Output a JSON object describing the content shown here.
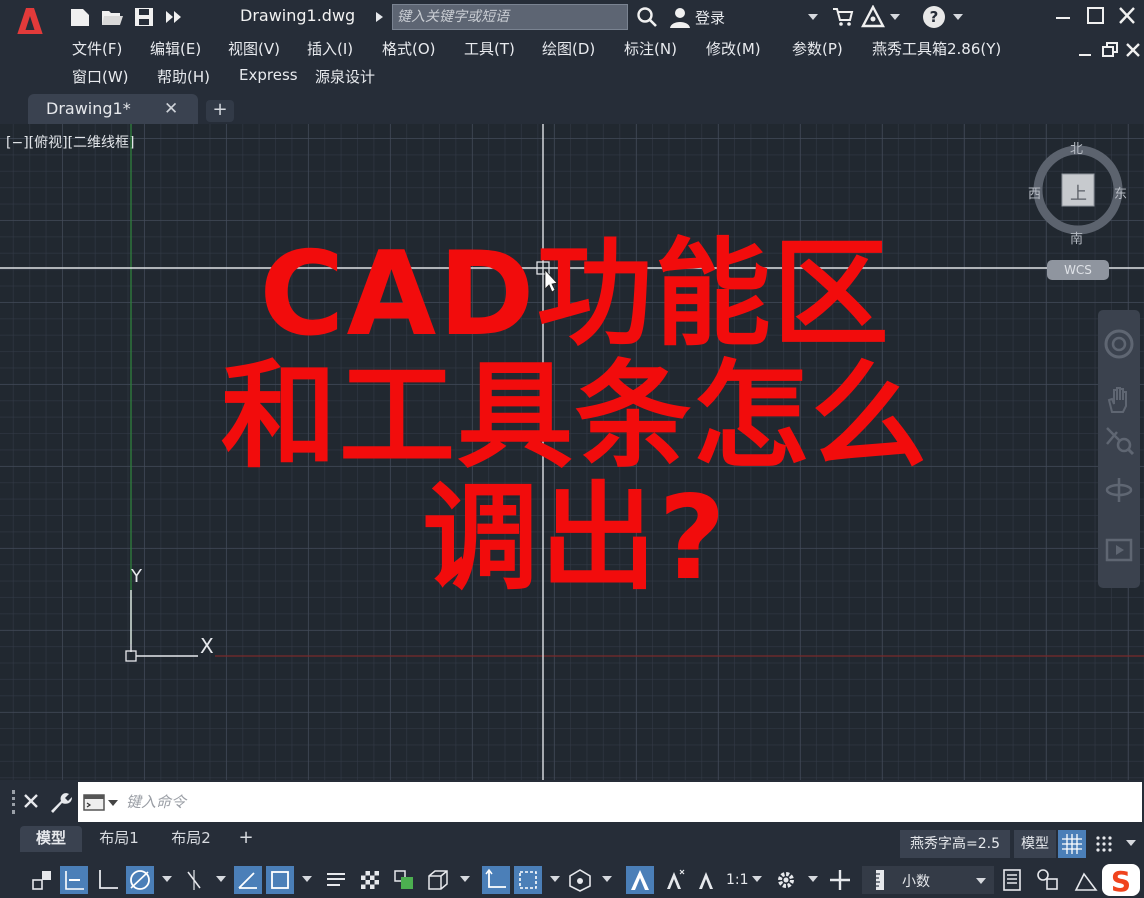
{
  "title_bar": {
    "filename": "Drawing1.dwg",
    "search_placeholder": "键入关键字或短语",
    "login_label": "登录"
  },
  "menu": {
    "items_row1": [
      "文件(F)",
      "编辑(E)",
      "视图(V)",
      "插入(I)",
      "格式(O)",
      "工具(T)",
      "绘图(D)",
      "标注(N)",
      "修改(M)",
      "参数(P)",
      "燕秀工具箱2.86(Y)"
    ],
    "items_row2": [
      "窗口(W)",
      "帮助(H)",
      "Express",
      "源泉设计"
    ]
  },
  "tabs": {
    "drawing_tab": "Drawing1*"
  },
  "canvas": {
    "viewport_label": "[−][俯视][二维线框]",
    "overlay_lines": [
      "CAD功能区",
      "和工具条怎么",
      "调出?"
    ],
    "overlay_color": "#f20c0c",
    "ucs_y": "Y",
    "ucs_x": "X",
    "viewcube": {
      "north": "北",
      "south": "南",
      "east": "东",
      "west": "西",
      "face": "上",
      "wcs": "WCS"
    }
  },
  "command_line": {
    "placeholder": "键入命令"
  },
  "layout_tabs": {
    "model": "模型",
    "layout1": "布局1",
    "layout2": "布局2"
  },
  "status_bar": {
    "text_height": "燕秀字高=2.5",
    "model_button": "模型",
    "scale": "1:1",
    "units": "小数",
    "accent_color": "#4b7fb8"
  }
}
